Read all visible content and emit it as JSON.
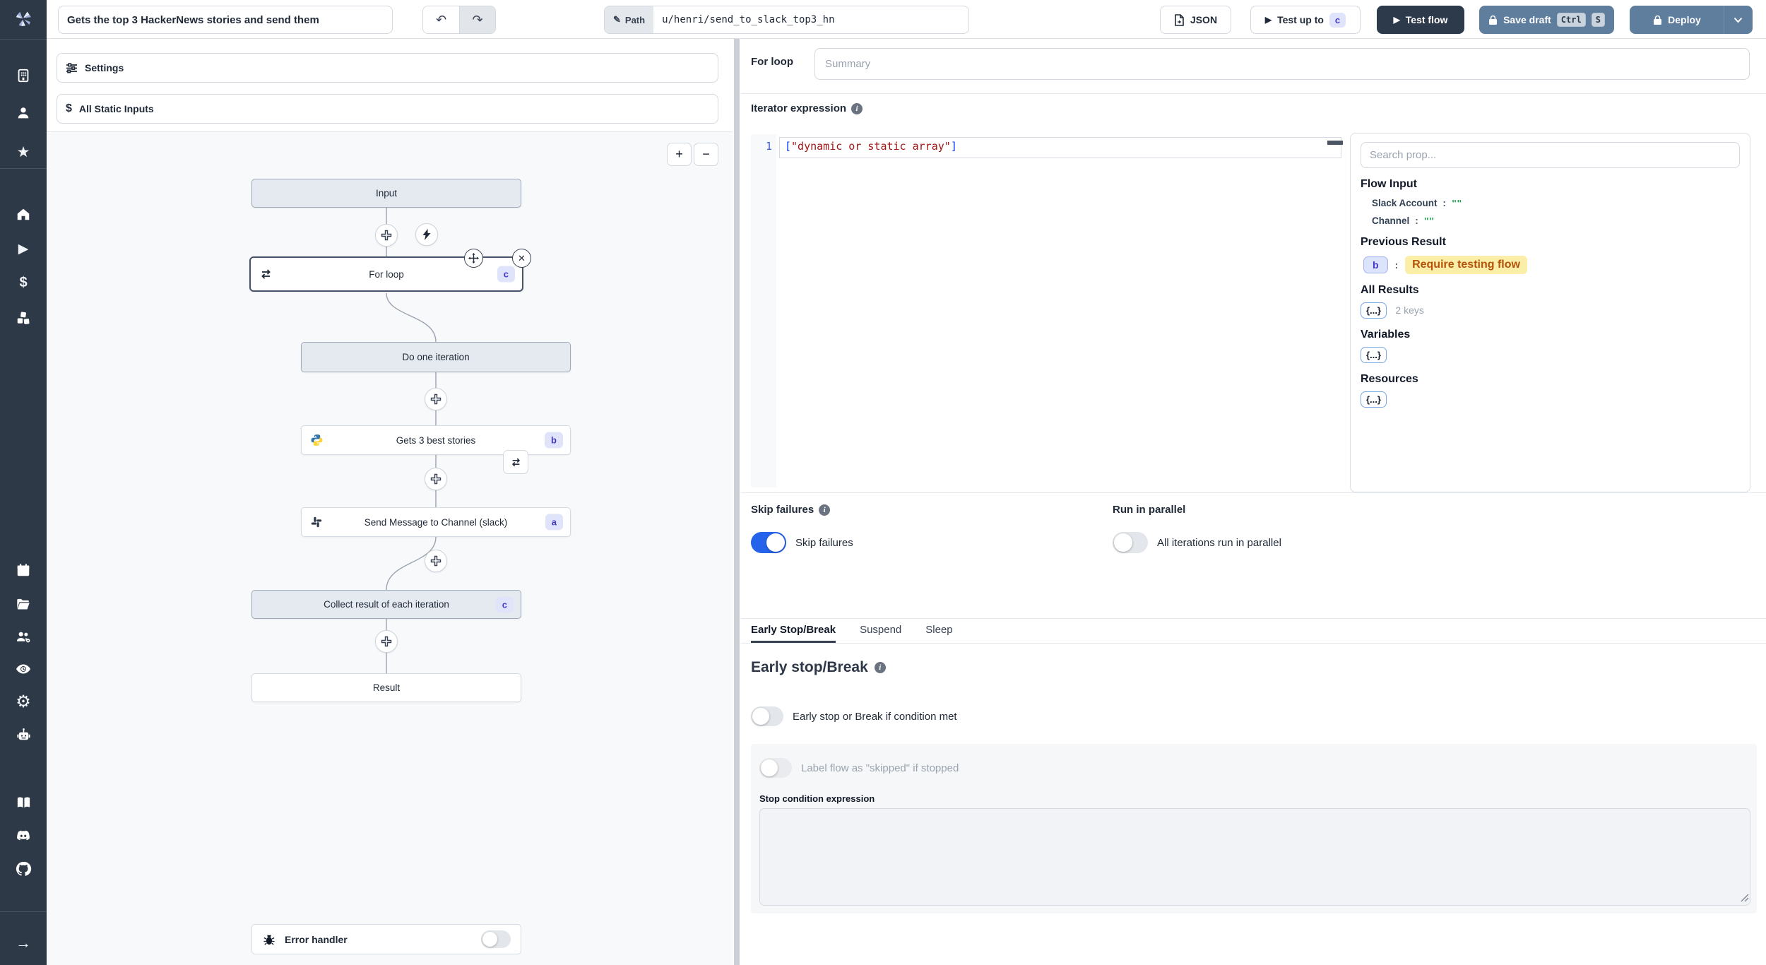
{
  "topbar": {
    "title_value": "Gets the top 3 HackerNews stories and send them",
    "path_label": "Path",
    "path_value": "u/henri/send_to_slack_top3_hn",
    "json_label": "JSON",
    "test_up_to_label": "Test up to",
    "test_up_to_badge": "c",
    "test_flow_label": "Test flow",
    "save_draft_label": "Save draft",
    "key_ctrl": "Ctrl",
    "key_s": "S",
    "deploy_label": "Deploy"
  },
  "glyphs": {
    "undo": "↶",
    "redo": "↷",
    "pencil": "✎",
    "play": "▶",
    "plus": "+",
    "minus": "−",
    "close": "✕",
    "star": "★",
    "dollar": "$",
    "gear": "⚙",
    "arrow_right": "→",
    "chevron": "▾"
  },
  "left_panel": {
    "settings_label": "Settings",
    "static_inputs_label": "All Static Inputs"
  },
  "flow": {
    "input_label": "Input",
    "for_loop": {
      "label": "For loop",
      "badge": "c"
    },
    "do_one_iteration_label": "Do one iteration",
    "gets_stories": {
      "label": "Gets 3 best stories",
      "badge": "b"
    },
    "send_message": {
      "label": "Send Message to Channel (slack)",
      "badge": "a"
    },
    "collect": {
      "label": "Collect result of each iteration",
      "badge": "c"
    },
    "result_label": "Result",
    "error_handler_label": "Error handler"
  },
  "inspector": {
    "module_label": "For loop",
    "summary_placeholder": "Summary",
    "iterator_label": "Iterator expression",
    "code": {
      "line_number": "1",
      "bracket_open": "[",
      "string": "\"dynamic or static array\"",
      "bracket_close": "]"
    },
    "props": {
      "search_placeholder": "Search prop...",
      "flow_input_heading": "Flow Input",
      "slack_account_key": "Slack Account",
      "channel_key": "Channel",
      "colon": ":",
      "empty_string_value": "\"\"",
      "previous_result_heading": "Previous Result",
      "prev_badge": "b",
      "prev_value": "Require testing flow",
      "all_results_heading": "All Results",
      "object_chip": "{...}",
      "all_results_meta": "2 keys",
      "variables_heading": "Variables",
      "resources_heading": "Resources"
    },
    "loop_settings": {
      "skip_failures_heading": "Skip failures",
      "run_in_parallel_heading": "Run in parallel",
      "skip_failures_toggle_label": "Skip failures",
      "parallel_toggle_label": "All iterations run in parallel"
    },
    "tabs": [
      {
        "label": "Early Stop/Break"
      },
      {
        "label": "Suspend"
      },
      {
        "label": "Sleep"
      }
    ],
    "early_stop": {
      "heading": "Early stop/Break",
      "condition_toggle_label": "Early stop or Break if condition met",
      "skipped_toggle_label": "Label flow as \"skipped\" if stopped",
      "stop_condition_label": "Stop condition expression"
    }
  },
  "colors": {
    "accent_blue": "#2563eb",
    "dark_navy": "#2d3a4c",
    "steel_blue": "#5f7d9d",
    "badge_bg": "#dfe4fb",
    "badge_text": "#4338ca",
    "highlight_bg": "#fbeea8",
    "highlight_text": "#b45309",
    "code_string_red": "#a31515",
    "code_bracket_blue": "#0433fa",
    "value_green": "#16a34a",
    "sidebar_dark": "#2e3947"
  }
}
